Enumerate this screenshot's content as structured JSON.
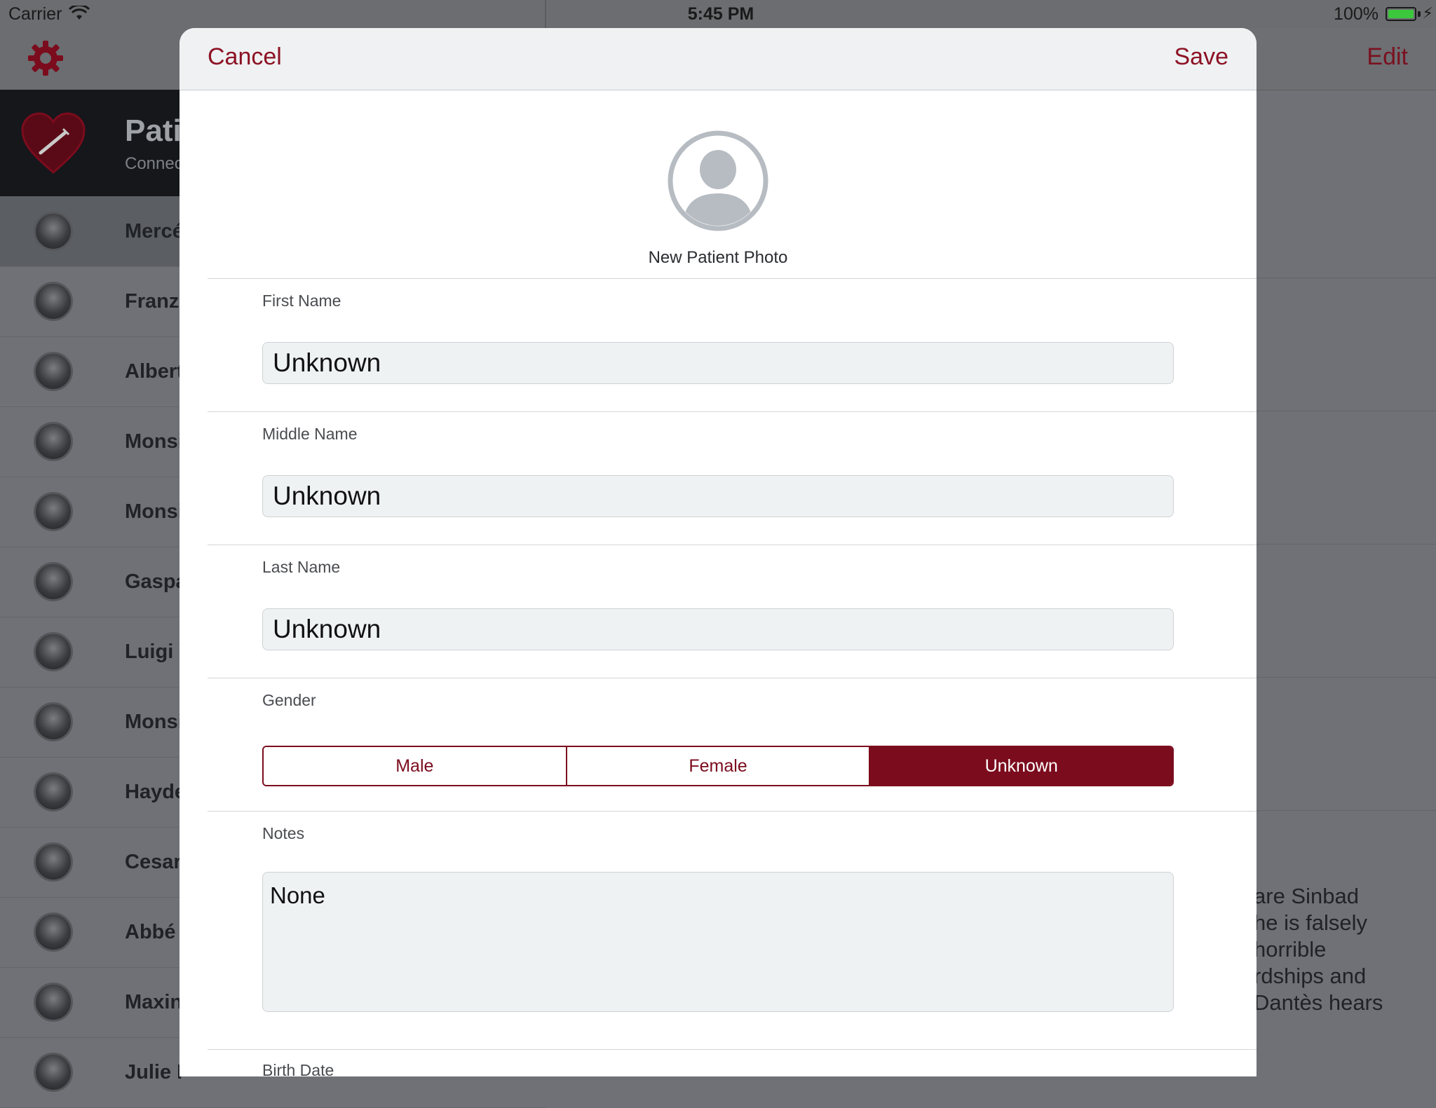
{
  "status_bar": {
    "carrier": "Carrier",
    "time": "5:45 PM",
    "battery": "100%"
  },
  "master": {
    "header_title": "Pati",
    "header_subtitle": "Connec",
    "patients": [
      "Mercé",
      "Franz",
      "Albert",
      "Monsi",
      "Monsi",
      "Gaspa",
      "Luigi V",
      "Monsi",
      "Hayde",
      "Cesar",
      "Abbé",
      "Maxin",
      "Julie I"
    ]
  },
  "detail": {
    "edit_label": "Edit",
    "text_lines": [
      "are Sinbad",
      "he is falsely",
      "horrible",
      "rdships and",
      "Dantès hears"
    ]
  },
  "modal": {
    "cancel_label": "Cancel",
    "save_label": "Save",
    "photo_label": "New Patient Photo",
    "first_name": {
      "label": "First Name",
      "value": "Unknown"
    },
    "middle_name": {
      "label": "Middle Name",
      "value": "Unknown"
    },
    "last_name": {
      "label": "Last Name",
      "value": "Unknown"
    },
    "gender": {
      "label": "Gender",
      "options": [
        "Male",
        "Female",
        "Unknown"
      ],
      "selected": "Unknown"
    },
    "notes": {
      "label": "Notes",
      "value": "None"
    },
    "birth_date": {
      "label": "Birth Date"
    }
  },
  "colors": {
    "accent": "#8c1224",
    "segment_active": "#7b0c1d",
    "battery": "#3cc83c"
  }
}
